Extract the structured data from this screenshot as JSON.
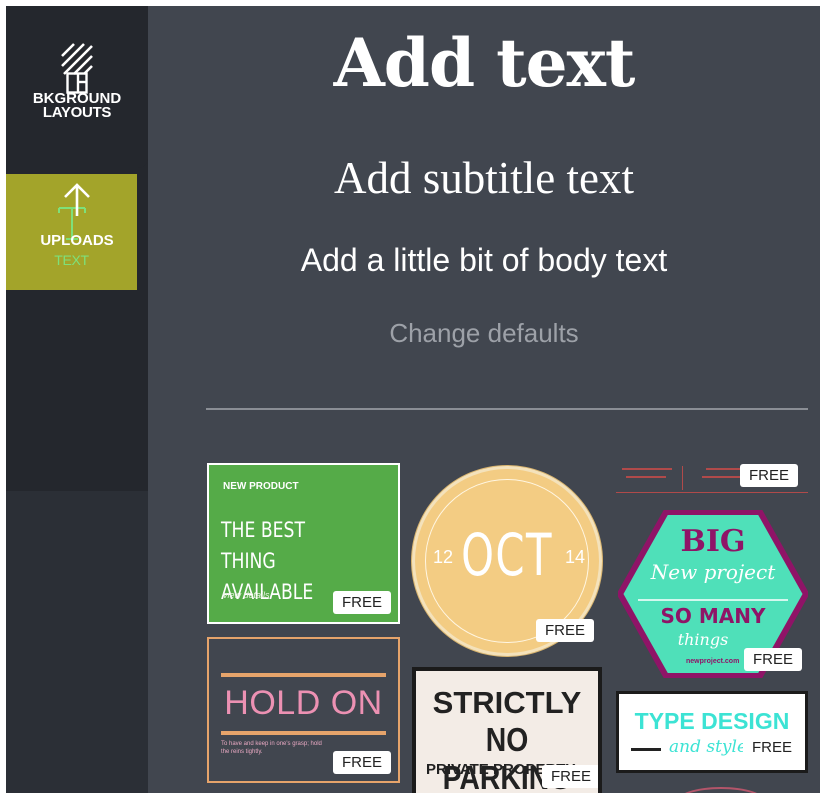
{
  "sidebar": {
    "items": [
      {
        "label": "LAYOUTS",
        "icon": "layout-icon"
      },
      {
        "label": "TEXT",
        "icon": "text-icon"
      },
      {
        "label": "BKGROUND",
        "icon": "background-icon"
      },
      {
        "label": "UPLOADS",
        "icon": "upload-icon"
      }
    ],
    "active_color": "#a3a42a",
    "active_text_color": "#7ee07a"
  },
  "text_panel": {
    "heading": "Add text",
    "subtitle": "Add subtitle text",
    "body": "Add a little bit of body text",
    "change_defaults": "Change defaults"
  },
  "badge": "FREE",
  "templates": {
    "green": {
      "eyebrow": "NEW PRODUCT",
      "title": "THE BEST THING AVAILABLE",
      "link": "view details",
      "badge": "FREE"
    },
    "oct": {
      "month": "OCT",
      "left": "12",
      "right": "14",
      "badge": "FREE"
    },
    "red": {
      "badge": "FREE"
    },
    "hex": {
      "big": "BIG",
      "line2": "New project",
      "line3": "SO MANY",
      "line4": "things",
      "url": "newproject.com",
      "badge": "FREE"
    },
    "hold": {
      "title": "HOLD ON",
      "sub": "To have and keep in one's grasp; hold the reins tightly.",
      "badge": "FREE"
    },
    "strict": {
      "l1": "STRICTLY",
      "l2": "NO PARKING",
      "l3": "PRIVATE PROPERTY",
      "badge": "FREE"
    },
    "type": {
      "title": "TYPE DESIGN",
      "script": "and style",
      "badge": "FREE"
    }
  }
}
